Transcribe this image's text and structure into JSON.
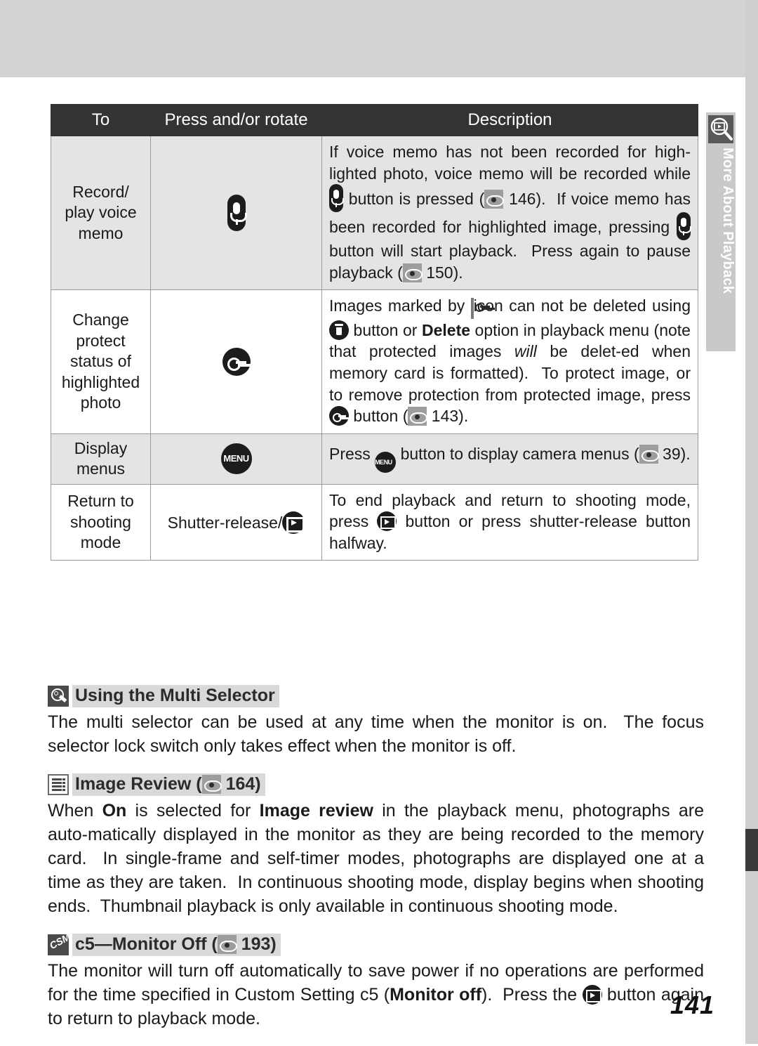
{
  "page": {
    "number": "141"
  },
  "side_tab": {
    "label": "More About Playback",
    "icon": "playback-magnifier-icon"
  },
  "table": {
    "headers": [
      "To",
      "Press and/or rotate",
      "Description"
    ],
    "rows": [
      {
        "to": "Record/\nplay voice\nmemo",
        "control_icon": "microphone-button-icon",
        "control_text": "",
        "description_parts": [
          {
            "t": "If voice memo has not been recorded for high-lighted photo, voice memo will be recorded while "
          },
          {
            "icon": "microphone-icon"
          },
          {
            "t": " button is pressed ("
          },
          {
            "icon": "page-reference-icon"
          },
          {
            "t": " 146).  If voice memo has been recorded for highlighted image, pressing "
          },
          {
            "icon": "microphone-icon"
          },
          {
            "t": " button will start playback.  Press again to pause playback ("
          },
          {
            "icon": "page-reference-icon"
          },
          {
            "t": " 150)."
          }
        ],
        "shaded": true
      },
      {
        "to": "Change\nprotect\nstatus of\nhighlighted\nphoto",
        "control_icon": "key-protect-button-icon",
        "control_text": "",
        "description_parts": [
          {
            "t": "Images marked by "
          },
          {
            "icon": "protect-marker-icon"
          },
          {
            "t": " icon can not be deleted using "
          },
          {
            "icon": "trash-icon"
          },
          {
            "t": " button or "
          },
          {
            "t": "Delete",
            "bold": true
          },
          {
            "t": " option in playback menu (note that protected images "
          },
          {
            "t": "will",
            "italic": true
          },
          {
            "t": " be delet-ed when memory card is formatted).  To protect image, or to remove protection from protected image, press "
          },
          {
            "icon": "key-icon"
          },
          {
            "t": " button ("
          },
          {
            "icon": "page-reference-icon"
          },
          {
            "t": " 143)."
          }
        ],
        "shaded": false
      },
      {
        "to": "Display\nmenus",
        "control_icon": "menu-button-icon",
        "control_text": "",
        "description_parts": [
          {
            "t": "Press "
          },
          {
            "icon": "menu-icon"
          },
          {
            "t": " button to display camera menus ("
          },
          {
            "icon": "page-reference-icon"
          },
          {
            "t": " 39)."
          }
        ],
        "shaded": true
      },
      {
        "to": "Return to\nshooting\nmode",
        "control_icon": "playback-button-icon",
        "control_text": "Shutter-release/",
        "description_parts": [
          {
            "t": "To end playback and return to shooting mode, press "
          },
          {
            "icon": "playback-icon"
          },
          {
            "t": " button or press shutter-release button halfway."
          }
        ],
        "shaded": false
      }
    ]
  },
  "tips": [
    {
      "badge": "lightbulb-icon",
      "title": "Using the Multi Selector",
      "body_parts": [
        {
          "t": "The multi selector can be used at any time when the monitor is on.  The focus selector lock switch only takes effect when the monitor is off."
        }
      ]
    },
    {
      "badge": "menu-list-icon",
      "title_parts": [
        {
          "t": "Image Review ("
        },
        {
          "icon": "page-reference-icon"
        },
        {
          "t": " 164)"
        }
      ],
      "title": "Image Review (164)",
      "body_parts": [
        {
          "t": "When "
        },
        {
          "t": "On",
          "bold": true
        },
        {
          "t": " is selected for "
        },
        {
          "t": "Image review",
          "bold": true
        },
        {
          "t": " in the playback menu, photographs are auto-matically displayed in the monitor as they are being recorded to the memory card.  In single-frame and self-timer modes, photographs are displayed one at a time as they are taken.  In continuous shooting mode, display begins when shooting ends.  Thumbnail playback is only available in continuous shooting mode."
        }
      ]
    },
    {
      "badge": "csm-icon",
      "badge_text": "CSM",
      "title_parts": [
        {
          "t": "c5—Monitor Off ("
        },
        {
          "icon": "page-reference-icon"
        },
        {
          "t": " 193)"
        }
      ],
      "title": "c5—Monitor Off (193)",
      "body_parts": [
        {
          "t": "The monitor will turn off automatically to save power if no operations are performed for the time specified in Custom Setting c5 ("
        },
        {
          "t": "Monitor off",
          "bold": true
        },
        {
          "t": ").  Press the "
        },
        {
          "icon": "playback-icon"
        },
        {
          "t": " button again to return to playback mode."
        }
      ]
    }
  ],
  "colors": {
    "header_bg": "#333333",
    "shaded_row": "#e4e4e4",
    "tab_bg": "#c9c9c9",
    "top_band": "#d3d3d3",
    "title_highlight": "#d9d9d9"
  }
}
